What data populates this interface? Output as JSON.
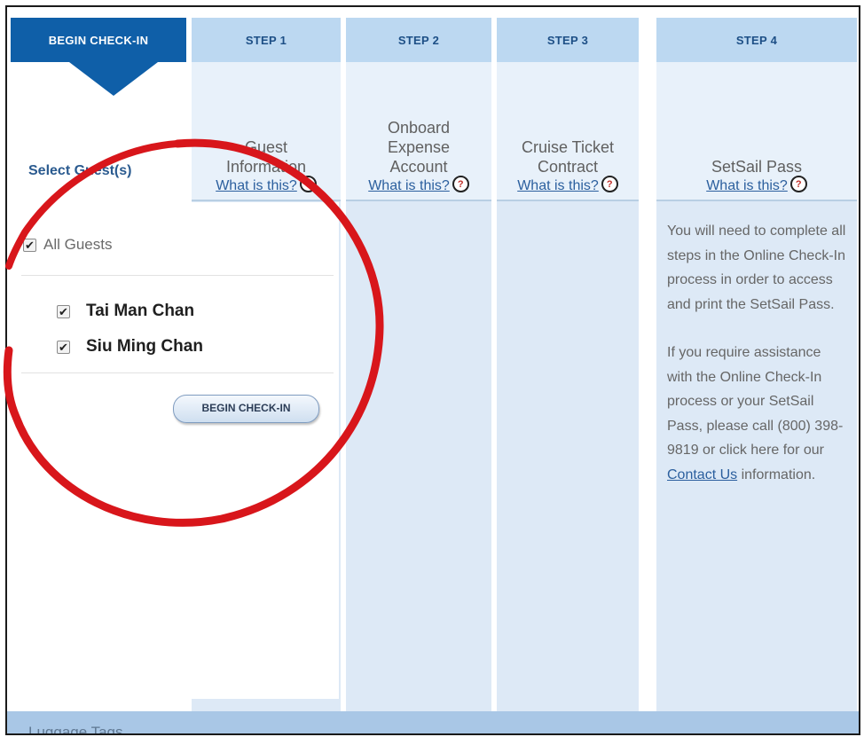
{
  "tabs": {
    "begin": "BEGIN CHECK-IN",
    "step1": "STEP 1",
    "step2": "STEP 2",
    "step3": "STEP 3",
    "step4": "STEP 4"
  },
  "columns": {
    "step1": {
      "title_lines": [
        "Guest",
        "Information"
      ],
      "help": "What is this?"
    },
    "step2": {
      "title_lines": [
        "Onboard",
        "Expense",
        "Account"
      ],
      "help": "What is this?"
    },
    "step3": {
      "title_lines": [
        "Cruise Ticket",
        "Contract"
      ],
      "help": "What is this?"
    },
    "step4": {
      "title_lines": [
        "SetSail Pass"
      ],
      "help": "What is this?"
    }
  },
  "help_icon": "?",
  "left": {
    "select_label": "Select Guest(s)",
    "all_guests": "All Guests",
    "guests": [
      "Tai Man Chan",
      "Siu Ming Chan"
    ],
    "begin_button": "BEGIN CHECK-IN"
  },
  "step4_info": {
    "para1": "You will need to complete all steps in the Online Check-In process in order to access and print the SetSail Pass.",
    "para2_prefix": "If you require assistance with the Online Check-In process or your SetSail Pass, please call (800) 398-9819 or click here for our",
    "contact_link": "Contact Us",
    "para2_suffix": "information."
  },
  "luggage": {
    "label": "Luggage Tags"
  },
  "icons": {
    "help": "question-bubble-icon",
    "check": "checkmark-icon",
    "annotation": "red-circle-annotation"
  },
  "colors": {
    "active_tab": "#0f5fa8",
    "tab": "#bcd8f1",
    "link": "#2b5f9e",
    "annotation": "#d8161b"
  },
  "checked": {
    "all_guests": true,
    "guest1": true,
    "guest2": true
  }
}
